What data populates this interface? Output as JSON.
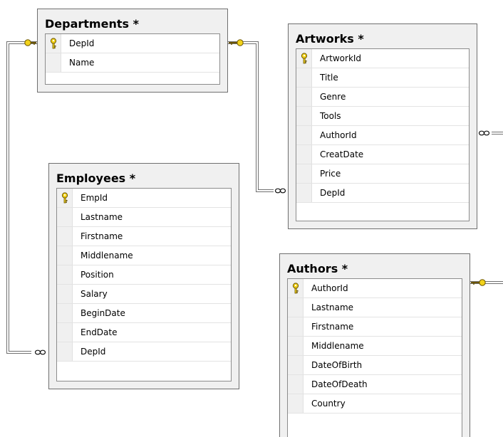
{
  "tables": {
    "departments": {
      "title": "Departments *",
      "columns": [
        {
          "name": "DepId",
          "primary_key": true
        },
        {
          "name": "Name",
          "primary_key": false
        }
      ]
    },
    "artworks": {
      "title": "Artworks *",
      "columns": [
        {
          "name": "ArtworkId",
          "primary_key": true
        },
        {
          "name": "Title",
          "primary_key": false
        },
        {
          "name": "Genre",
          "primary_key": false
        },
        {
          "name": "Tools",
          "primary_key": false
        },
        {
          "name": "AuthorId",
          "primary_key": false
        },
        {
          "name": "CreatDate",
          "primary_key": false
        },
        {
          "name": "Price",
          "primary_key": false
        },
        {
          "name": "DepId",
          "primary_key": false
        }
      ]
    },
    "employees": {
      "title": "Employees *",
      "columns": [
        {
          "name": "EmpId",
          "primary_key": true
        },
        {
          "name": "Lastname",
          "primary_key": false
        },
        {
          "name": "Firstname",
          "primary_key": false
        },
        {
          "name": "Middlename",
          "primary_key": false
        },
        {
          "name": "Position",
          "primary_key": false
        },
        {
          "name": "Salary",
          "primary_key": false
        },
        {
          "name": "BeginDate",
          "primary_key": false
        },
        {
          "name": "EndDate",
          "primary_key": false
        },
        {
          "name": "DepId",
          "primary_key": false
        }
      ]
    },
    "authors": {
      "title": "Authors *",
      "columns": [
        {
          "name": "AuthorId",
          "primary_key": true
        },
        {
          "name": "Lastname",
          "primary_key": false
        },
        {
          "name": "Firstname",
          "primary_key": false
        },
        {
          "name": "Middlename",
          "primary_key": false
        },
        {
          "name": "DateOfBirth",
          "primary_key": false
        },
        {
          "name": "DateOfDeath",
          "primary_key": false
        },
        {
          "name": "Country",
          "primary_key": false
        }
      ]
    }
  },
  "relationships": [
    {
      "name": "departments-employees",
      "one": "Departments.DepId",
      "many": "Employees.DepId"
    },
    {
      "name": "departments-artworks",
      "one": "Departments.DepId",
      "many": "Artworks.DepId"
    },
    {
      "name": "authors-artworks",
      "one": "Authors.AuthorId",
      "many": "Artworks.AuthorId"
    }
  ],
  "colors": {
    "key_icon": "#f2d21b",
    "key_icon_outline": "#6b5500",
    "connector_line": "#707070",
    "table_background": "#f0f0f0",
    "table_border": "#6f6f6f"
  }
}
